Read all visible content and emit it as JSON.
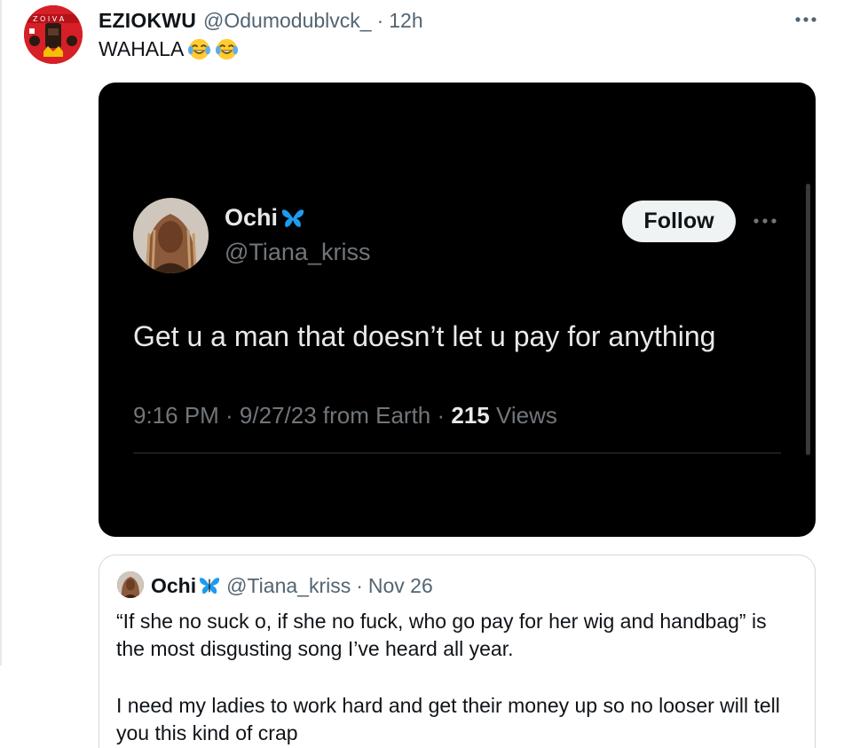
{
  "tweet": {
    "author_name": "EZIOKWU",
    "author_handle": "@Odumodublvck_",
    "separator": "·",
    "timestamp": "12h",
    "text": "WAHALA",
    "emojis": [
      "face-with-tears-of-joy",
      "face-with-tears-of-joy"
    ]
  },
  "embedded_tweet": {
    "name": "Ochi",
    "handle": "@Tiana_kriss",
    "follow_label": "Follow",
    "text": "Get u a man that doesn’t let u pay for anything",
    "meta_prefix": "9:16 PM · 9/27/23 from Earth · ",
    "views_count": "215",
    "views_label": " Views"
  },
  "quoted_tweet": {
    "name": "Ochi",
    "handle": "@Tiana_kriss",
    "separator": "·",
    "timestamp": "Nov 26",
    "paragraph1": "“If she no suck o, if she no fuck, who go pay for her wig and handbag” is the most disgusting song I’ve heard all year.",
    "paragraph2": "I need my ladies to work hard and get their money up so no looser will tell you this kind of crap"
  },
  "colors": {
    "text_primary": "#0f1419",
    "text_secondary": "#536471",
    "media_background": "#000000",
    "butterfly_blue": "#1d9bf0",
    "avatar_red": "#d61f26"
  }
}
